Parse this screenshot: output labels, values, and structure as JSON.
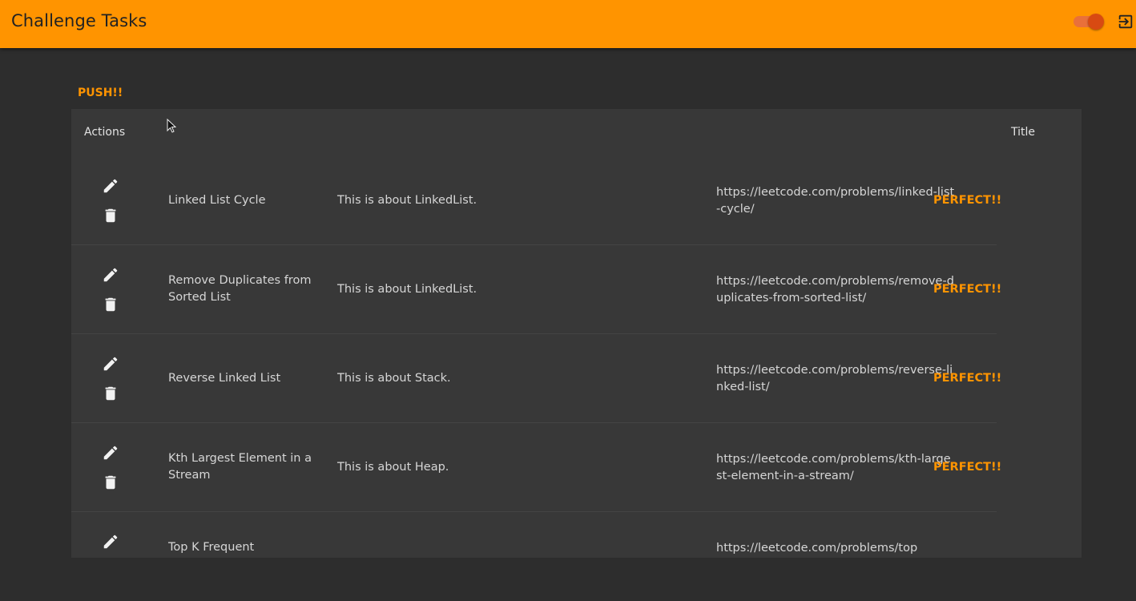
{
  "app": {
    "title": "Challenge Tasks",
    "accent": "#ff9400"
  },
  "section_label": "PUSH!!",
  "table": {
    "headers": {
      "actions": "Actions",
      "title": "Title"
    },
    "rows": [
      {
        "title": "Linked List Cycle",
        "description": "This is about LinkedList.",
        "url": "https://leetcode.com/problems/linked-list-cycle/",
        "status": "PERFECT!!"
      },
      {
        "title": "Remove Duplicates from Sorted List",
        "description": "This is about LinkedList.",
        "url": "https://leetcode.com/problems/remove-duplicates-from-sorted-list/",
        "status": "PERFECT!!"
      },
      {
        "title": "Reverse Linked List",
        "description": "This is about Stack.",
        "url": "https://leetcode.com/problems/reverse-linked-list/",
        "status": "PERFECT!!"
      },
      {
        "title": "Kth Largest Element in a Stream",
        "description": "This is about Heap.",
        "url": "https://leetcode.com/problems/kth-largest-element-in-a-stream/",
        "status": "PERFECT!!"
      },
      {
        "title": "Top K Frequent",
        "description": "",
        "url": "https://leetcode.com/problems/top",
        "status": ""
      }
    ]
  },
  "icons": {
    "edit": "pencil-icon",
    "delete": "trash-icon",
    "logout": "logout-icon",
    "toggle": "theme-toggle"
  }
}
